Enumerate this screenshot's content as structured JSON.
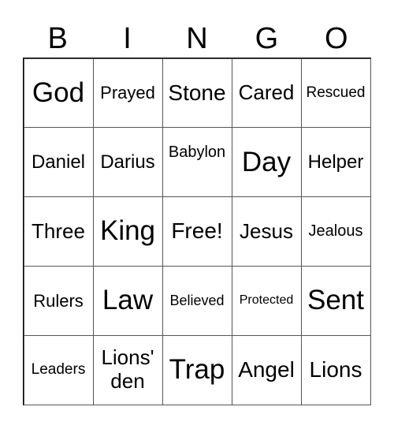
{
  "header": {
    "letters": [
      "B",
      "I",
      "N",
      "G",
      "O"
    ]
  },
  "cells": [
    [
      "God",
      "Prayed",
      "Stone",
      "Cared",
      "Rescued"
    ],
    [
      "Daniel",
      "Darius",
      "Babylon",
      "Day",
      "Helper"
    ],
    [
      "Three",
      "King",
      "Free!",
      "Jesus",
      "Jealous"
    ],
    [
      "Rulers",
      "Law",
      "Believed",
      "Protected",
      "Sent"
    ],
    [
      "Leaders",
      "Lions' den",
      "Trap",
      "Angel",
      "Lions"
    ]
  ]
}
